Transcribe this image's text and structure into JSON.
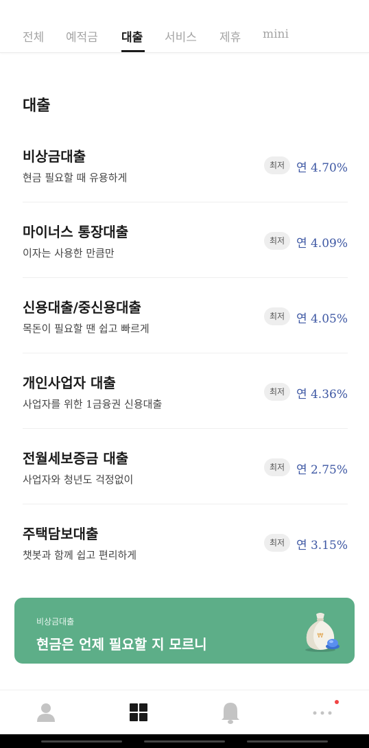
{
  "tabs": [
    {
      "label": "전체",
      "active": false
    },
    {
      "label": "예적금",
      "active": false
    },
    {
      "label": "대출",
      "active": true
    },
    {
      "label": "서비스",
      "active": false
    },
    {
      "label": "제휴",
      "active": false
    },
    {
      "label": "mini",
      "active": false
    }
  ],
  "section_title": "대출",
  "loans": [
    {
      "name": "비상금대출",
      "desc": "현금 필요할 때 유용하게",
      "badge": "최저",
      "rate": "연 4.70%"
    },
    {
      "name": "마이너스 통장대출",
      "desc": "이자는 사용한 만큼만",
      "badge": "최저",
      "rate": "연 4.09%"
    },
    {
      "name": "신용대출/중신용대출",
      "desc": "목돈이 필요할 땐 쉽고 빠르게",
      "badge": "최저",
      "rate": "연 4.05%"
    },
    {
      "name": "개인사업자 대출",
      "desc": "사업자를 위한 1금융권 신용대출",
      "badge": "최저",
      "rate": "연 4.36%"
    },
    {
      "name": "전월세보증금 대출",
      "desc": "사업자와 청년도 걱정없이",
      "badge": "최저",
      "rate": "연 2.75%"
    },
    {
      "name": "주택담보대출",
      "desc": "챗봇과 함께 쉽고 편리하게",
      "badge": "최저",
      "rate": "연 3.15%"
    }
  ],
  "banner": {
    "subtitle": "비상금대출",
    "title": "현금은 언제 필요할 지 모르니",
    "icon": "money-bag-icon",
    "color": "#5dae88"
  },
  "bottom_nav": [
    {
      "icon": "person-icon",
      "active": false
    },
    {
      "icon": "grid-icon",
      "active": true
    },
    {
      "icon": "bell-icon",
      "active": false
    },
    {
      "icon": "more-icon",
      "active": false,
      "notification_dot": true
    }
  ],
  "colors": {
    "rate": "#3d57a3",
    "accent": "#5dae88",
    "dot": "#f04444"
  }
}
